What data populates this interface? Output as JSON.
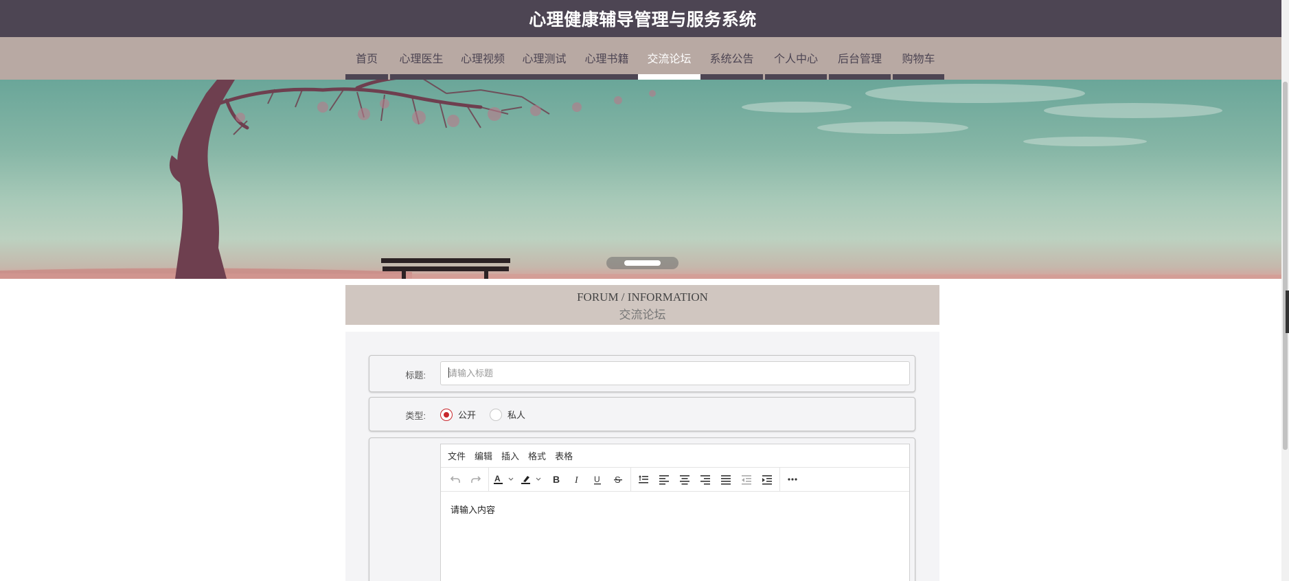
{
  "header": {
    "title": "心理健康辅导管理与服务系统"
  },
  "nav": {
    "items": [
      {
        "label": "首页",
        "active": false
      },
      {
        "label": "心理医生",
        "active": false
      },
      {
        "label": "心理视频",
        "active": false
      },
      {
        "label": "心理测试",
        "active": false
      },
      {
        "label": "心理书籍",
        "active": false
      },
      {
        "label": "交流论坛",
        "active": true
      },
      {
        "label": "系统公告",
        "active": false
      },
      {
        "label": "个人中心",
        "active": false
      },
      {
        "label": "后台管理",
        "active": false
      },
      {
        "label": "购物车",
        "active": false
      }
    ]
  },
  "banner": {
    "carousel_current_slide": 1,
    "carousel_total_slides": 1
  },
  "section": {
    "title_en": "FORUM / INFORMATION",
    "title_cn": "交流论坛"
  },
  "form": {
    "title_label": "标题:",
    "title_placeholder": "请输入标题",
    "title_value": "",
    "type_label": "类型:",
    "type_options": [
      {
        "label": "公开",
        "checked": true
      },
      {
        "label": "私人",
        "checked": false
      }
    ],
    "editor": {
      "menu": [
        "文件",
        "编辑",
        "插入",
        "格式",
        "表格"
      ],
      "toolbar": [
        "undo-icon",
        "redo-icon",
        "font-color-icon",
        "highlight-icon",
        "bold-icon",
        "italic-icon",
        "underline-icon",
        "strikethrough-icon",
        "line-height-icon",
        "align-left-icon",
        "align-center-icon",
        "align-right-icon",
        "align-justify-icon",
        "outdent-icon",
        "indent-icon",
        "more-icon"
      ],
      "content_placeholder": "请输入内容"
    }
  },
  "colors": {
    "header_bg": "#4d4553",
    "nav_bg": "#b8a9a3",
    "section_head_bg": "#d0c6c0",
    "form_bg": "#f4f4f6",
    "radio_accent": "#c8262c"
  }
}
